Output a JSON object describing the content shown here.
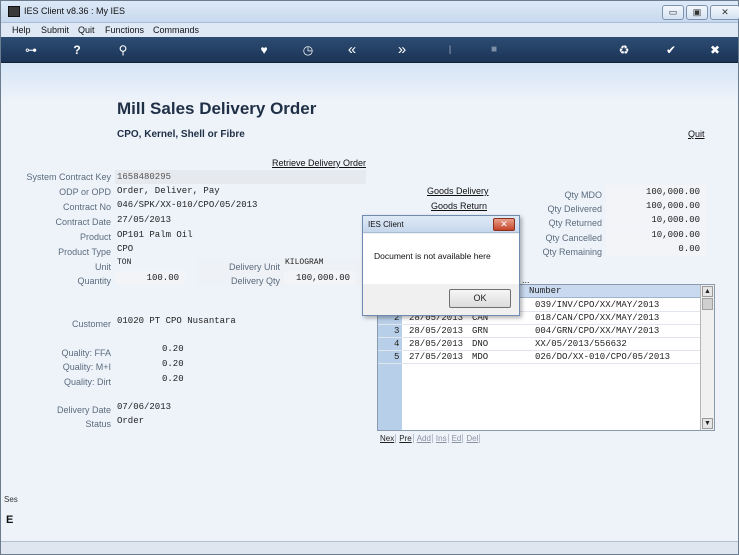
{
  "window": {
    "title": "IES Client v8.36 : My IES",
    "min_label": "▭",
    "max_label": "▣",
    "close_label": "✕"
  },
  "menu": [
    "Help",
    "Submit",
    "Quit",
    "Functions",
    "Commands"
  ],
  "toolbar": {
    "icons": [
      "key-icon",
      "help-icon",
      "search-icon",
      "heart-icon",
      "clock-icon",
      "rewind-icon",
      "forward-icon",
      "text-cursor-icon",
      "stop-icon",
      "recycle-icon",
      "check-icon",
      "close-icon"
    ],
    "glyphs": {
      "key": "⊶",
      "help": "?",
      "search": "⚲",
      "heart": "♥",
      "clock": "◷",
      "rewind": "«",
      "forward": "»",
      "cursor": "I",
      "stop": "■",
      "recycle": "♻",
      "check": "✔",
      "close": "✖"
    }
  },
  "page": {
    "title": "Mill Sales Delivery Order",
    "subtitle": "CPO, Kernel, Shell or Fibre",
    "quit_label": "Quit",
    "retrieve_label": "Retrieve Delivery Order"
  },
  "form": {
    "system_contract_key_label": "System Contract Key",
    "system_contract_key": "1658480295",
    "odp_label": "ODP or OPD",
    "odp": "Order, Deliver, Pay",
    "contract_no_label": "Contract No",
    "contract_no": "046/SPK/XX-010/CPO/05/2013",
    "contract_date_label": "Contract Date",
    "contract_date": "27/05/2013",
    "product_label": "Product",
    "product": "OP101 Palm Oil",
    "product_type_label": "Product Type",
    "product_type": "CPO",
    "unit_label": "Unit",
    "unit": "TON",
    "delivery_unit_label": "Delivery Unit",
    "delivery_unit": "KILOGRAM",
    "quantity_label": "Quantity",
    "quantity": "100.00",
    "delivery_qty_label": "Delivery Qty",
    "delivery_qty": "100,000.00",
    "customer_label": "Customer",
    "customer": "01020 PT CPO Nusantara",
    "quality_ffa_label": "Quality: FFA",
    "quality_ffa": "0.20",
    "quality_mi_label": "Quality: M+I",
    "quality_mi": "0.20",
    "quality_dirt_label": "Quality: Dirt",
    "quality_dirt": "0.20",
    "delivery_date_label": "Delivery Date",
    "delivery_date": "07/06/2013",
    "status_label": "Status",
    "status": "Order"
  },
  "right": {
    "goods_delivery_label": "Goods Delivery",
    "goods_return_label": "Goods Return",
    "qty_mdo_label": "Qty MDO",
    "qty_mdo": "100,000.00",
    "qty_delivered_label": "Qty Delivered",
    "qty_delivered": "100,000.00",
    "qty_returned_label": "Qty Returned",
    "qty_returned": "10,000.00",
    "qty_cancelled_label": "Qty Cancelled",
    "qty_cancelled": "10,000.00",
    "qty_remaining_label": "Qty Remaining",
    "qty_remaining": "0.00",
    "docs_label": "s ..."
  },
  "grid": {
    "header": {
      "number": "Number"
    },
    "rows": [
      {
        "n": "",
        "date": "",
        "type": "",
        "number": "039/INV/CPO/XX/MAY/2013"
      },
      {
        "n": "2",
        "date": "28/05/2013",
        "type": "CAN",
        "number": "018/CAN/CPO/XX/MAY/2013"
      },
      {
        "n": "3",
        "date": "28/05/2013",
        "type": "GRN",
        "number": "004/GRN/CPO/XX/MAY/2013"
      },
      {
        "n": "4",
        "date": "28/05/2013",
        "type": "DNO",
        "number": "XX/05/2013/556632"
      },
      {
        "n": "5",
        "date": "27/05/2013",
        "type": "MDO",
        "number": "026/DO/XX-010/CPO/05/2013"
      }
    ],
    "buttons": [
      "Nex",
      "Pre",
      "Add",
      "Ins",
      "Ed",
      "Del"
    ]
  },
  "dialog": {
    "title": "IES Client",
    "message": "Document is not available here",
    "ok_label": "OK",
    "close_label": "✕"
  },
  "side": {
    "tab1": "Ses",
    "tab2": "E"
  }
}
